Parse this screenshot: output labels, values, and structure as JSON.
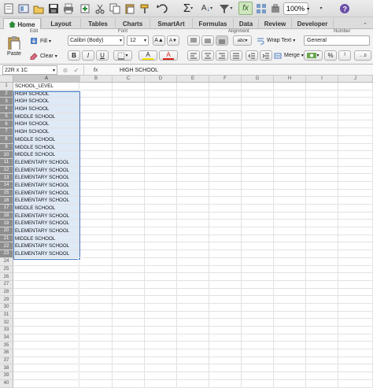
{
  "tabs": [
    "Home",
    "Layout",
    "Tables",
    "Charts",
    "SmartArt",
    "Formulas",
    "Data",
    "Review",
    "Developer"
  ],
  "zoom": "100%",
  "ribbon": {
    "groups": {
      "edit": "Edit",
      "font": "Font",
      "alignment": "Alignment",
      "number": "Number"
    },
    "paste_label": "Paste",
    "fill_label": "Fill",
    "clear_label": "Clear",
    "font_name": "Calibri (Body)",
    "font_size": "12",
    "wrap_text_label": "Wrap Text",
    "merge_label": "Merge",
    "number_format": "General",
    "abc_label": "abc",
    "percent": "%",
    "bold": "B",
    "italic": "I",
    "underline": "U",
    "grow_font": "A▲",
    "shrink_font": "A▼",
    "fill_color_letter": "A",
    "font_color_letter": "A"
  },
  "formula_bar": {
    "name_box": "22R x 1C",
    "fx": "fx",
    "content": "HIGH SCHOOL"
  },
  "columns": [
    "A",
    "B",
    "C",
    "D",
    "E",
    "F",
    "G",
    "H",
    "I",
    "J"
  ],
  "rows": [
    {
      "num": "1",
      "a": "SCHOOL_LEVEL"
    },
    {
      "num": "2",
      "a": "HIGH SCHOOL"
    },
    {
      "num": "3",
      "a": "HIGH SCHOOL"
    },
    {
      "num": "4",
      "a": "HIGH SCHOOL"
    },
    {
      "num": "5",
      "a": "MIDDLE SCHOOL"
    },
    {
      "num": "6",
      "a": "HIGH SCHOOL"
    },
    {
      "num": "7",
      "a": "HIGH SCHOOL"
    },
    {
      "num": "8",
      "a": "MIDDLE SCHOOL"
    },
    {
      "num": "9",
      "a": "MIDDLE SCHOOL"
    },
    {
      "num": "10",
      "a": "MIDDLE SCHOOL"
    },
    {
      "num": "11",
      "a": "ELEMENTARY SCHOOL"
    },
    {
      "num": "12",
      "a": "ELEMENTARY SCHOOL"
    },
    {
      "num": "13",
      "a": "ELEMENTARY SCHOOL"
    },
    {
      "num": "14",
      "a": "ELEMENTARY SCHOOL"
    },
    {
      "num": "15",
      "a": "ELEMENTARY SCHOOL"
    },
    {
      "num": "16",
      "a": "ELEMENTARY SCHOOL"
    },
    {
      "num": "17",
      "a": "MIDDLE SCHOOL"
    },
    {
      "num": "18",
      "a": "ELEMENTARY SCHOOL"
    },
    {
      "num": "19",
      "a": "ELEMENTARY SCHOOL"
    },
    {
      "num": "20",
      "a": "ELEMENTARY SCHOOL"
    },
    {
      "num": "21",
      "a": "MIDDLE SCHOOL"
    },
    {
      "num": "22",
      "a": "ELEMENTARY SCHOOL"
    },
    {
      "num": "23",
      "a": "ELEMENTARY SCHOOL"
    },
    {
      "num": "24",
      "a": ""
    },
    {
      "num": "25",
      "a": ""
    },
    {
      "num": "26",
      "a": ""
    },
    {
      "num": "27",
      "a": ""
    },
    {
      "num": "28",
      "a": ""
    },
    {
      "num": "29",
      "a": ""
    },
    {
      "num": "30",
      "a": ""
    },
    {
      "num": "31",
      "a": ""
    },
    {
      "num": "32",
      "a": ""
    },
    {
      "num": "33",
      "a": ""
    },
    {
      "num": "34",
      "a": ""
    },
    {
      "num": "35",
      "a": ""
    },
    {
      "num": "36",
      "a": ""
    },
    {
      "num": "37",
      "a": ""
    },
    {
      "num": "38",
      "a": ""
    },
    {
      "num": "39",
      "a": ""
    },
    {
      "num": "40",
      "a": ""
    }
  ],
  "selected_rows": [
    "2",
    "3",
    "4",
    "5",
    "6",
    "7",
    "8",
    "9",
    "10",
    "11",
    "12",
    "13",
    "14",
    "15",
    "16",
    "17",
    "18",
    "19",
    "20",
    "21",
    "22",
    "23"
  ],
  "colors": {
    "accent": "#4a7cc4",
    "selection_fill": "#dfeaf7",
    "font_red": "#d9201a",
    "fill_yellow": "#f5e000",
    "home_icon": "#2e8b3a"
  }
}
